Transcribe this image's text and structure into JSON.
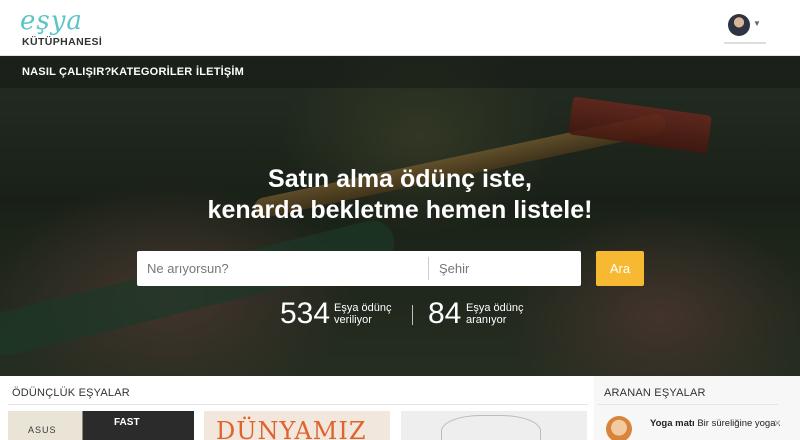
{
  "header": {
    "logo_text": "eşya",
    "logo_subtitle": "KÜTÜPHANESİ"
  },
  "nav": {
    "items": [
      "NASIL ÇALIŞIR?",
      "KATEGORİLER",
      "İLETİŞİM"
    ]
  },
  "hero": {
    "headline_line1": "Satın alma ödünç iste,",
    "headline_line2": "kenarda bekletme hemen listele!",
    "search": {
      "query_placeholder": "Ne arıyorsun?",
      "city_placeholder": "Şehir",
      "button_label": "Ara"
    },
    "stats": [
      {
        "number": "534",
        "label_line1": "Eşya ödünç",
        "label_line2": "veriliyor"
      },
      {
        "number": "84",
        "label_line1": "Eşya ödünç",
        "label_line2": "aranıyor"
      }
    ]
  },
  "sections": {
    "left_title": "ÖDÜNÇLÜK EŞYALAR",
    "right_title": "ARANAN EŞYALAR",
    "cards": [
      {
        "brand": "ASUS",
        "word": "FAST"
      },
      {
        "word": "DÜNYAMIZ"
      },
      {
        "word": ""
      }
    ],
    "aranan": {
      "title": "Yoga matı",
      "snippet": "Bir süreliğine yoga ...",
      "close_icon": "×"
    }
  },
  "colors": {
    "accent": "#f6b931",
    "logo": "#5bc4c8"
  }
}
